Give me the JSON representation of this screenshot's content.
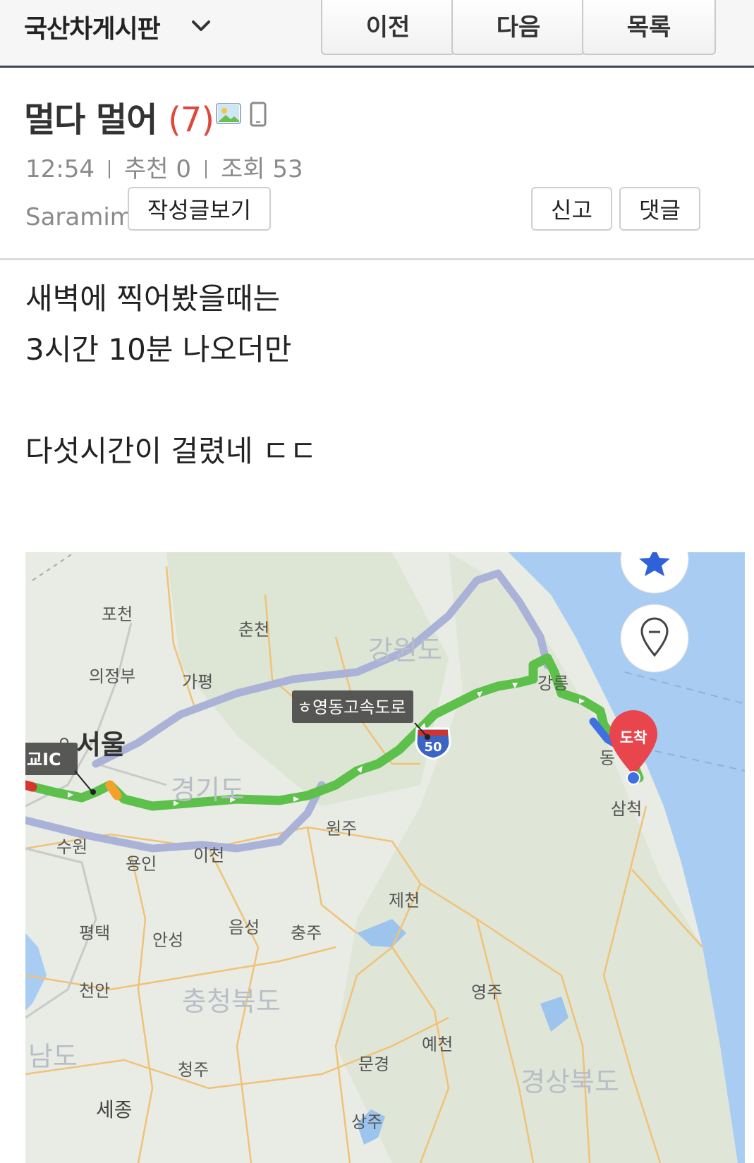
{
  "header": {
    "board_name": "국산차게시판",
    "prev_label": "이전",
    "next_label": "다음",
    "list_label": "목록"
  },
  "post": {
    "title": "멀다 멀어",
    "comment_count": "(7)",
    "time": "12:54",
    "likes": "추천 0",
    "views": "조회 53",
    "author": "Saramim",
    "view_posts_label": "작성글보기",
    "report_label": "신고",
    "comment_label": "댓글",
    "body_lines": [
      "새벽에 찍어봤을때는",
      "3시간 10분 나오더만",
      "다섯시간이 걸렸네 ㄷㄷ"
    ]
  },
  "map": {
    "places": {
      "pocheon": "포천",
      "chuncheon": "춘천",
      "gangwon": "강원도",
      "uijeongbu": "의정부",
      "gapyeong": "가평",
      "seoul": "서울",
      "gyeonggi": "경기도",
      "suwon": "수원",
      "yongin": "용인",
      "icheon": "이천",
      "wonju": "원주",
      "jecheon": "제천",
      "pyeongtaek": "평택",
      "anseong": "안성",
      "eumseong": "음성",
      "chungju": "충주",
      "cheonan": "천안",
      "chungbuk": "충청북도",
      "yeongju": "영주",
      "chungnam": "남도",
      "cheongju": "청주",
      "mungyeong": "문경",
      "yecheon": "예천",
      "gyeongbuk": "경상북도",
      "sejong": "세종",
      "sangju": "상주",
      "gangneung": "강릉",
      "samcheok": "삼척",
      "donghae": "동"
    },
    "highway_label": "영동고속도로",
    "highway_prefix": "ㅎ",
    "ic_label": "교IC",
    "shield_number": "50",
    "destination_label": "도착",
    "colors": {
      "route": "#5cc04a",
      "alt_route": "#aab2d8",
      "water": "#a9cdf2",
      "pin": "#e8454c"
    }
  }
}
